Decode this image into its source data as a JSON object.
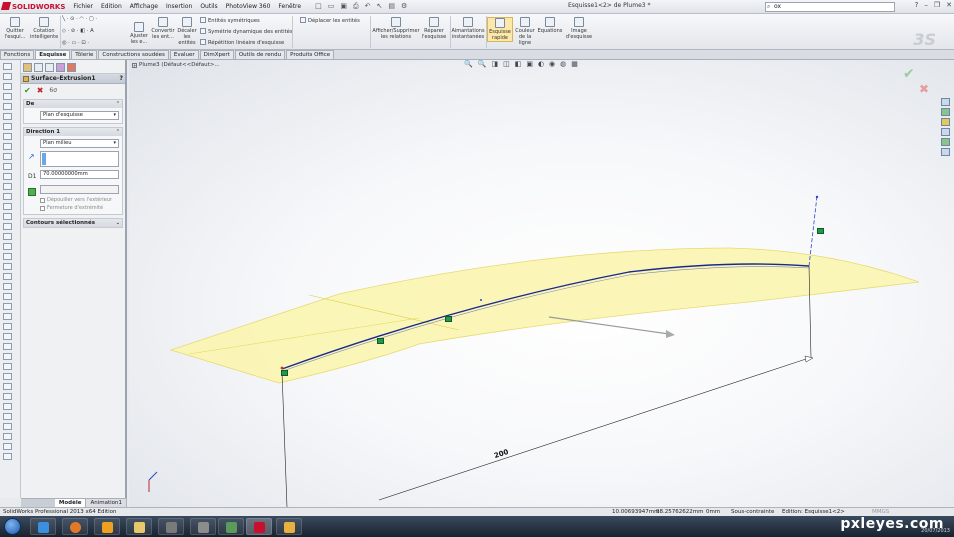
{
  "app": {
    "logo_text": "SOLIDWORKS",
    "doc_title": "Esquisse1<2> de Plume3 *",
    "search_value": "ox",
    "menu": [
      "Fichier",
      "Edition",
      "Affichage",
      "Insertion",
      "Outils",
      "PhotoView 360",
      "Fenêtre"
    ]
  },
  "ribbon": {
    "buttons": [
      {
        "label": "Quitter l'esqui..."
      },
      {
        "label": "Cotation intelligente"
      },
      {
        "label": "Ajuster les e..."
      },
      {
        "label": "Convertir les ent..."
      },
      {
        "label": "Décaler les entités"
      },
      {
        "label": "Afficher/Supprimer les relations"
      },
      {
        "label": "Réparer l'esquisse"
      },
      {
        "label": "Aimantations instantanées"
      },
      {
        "label": "Esquisse rapide"
      },
      {
        "label": "Couleur de la ligne"
      },
      {
        "label": "Equations"
      },
      {
        "label": "Image d'esquisse"
      }
    ],
    "rows": {
      "mirror": "Entités symétriques",
      "dyn_mirror": "Symétrie dynamique des entités",
      "linear_pattern": "Répétition linéaire d'esquisse",
      "move": "Déplacer les entités"
    }
  },
  "tabs": [
    "Fonctions",
    "Esquisse",
    "Tôlerie",
    "Constructions soudées",
    "Evaluer",
    "DimXpert",
    "Outils de rendu",
    "Produits Office"
  ],
  "active_tab": "Esquisse",
  "property_manager": {
    "title": "Surface-Extrusion1",
    "help": "?",
    "from_group": {
      "title": "De",
      "value": "Plan d'esquisse"
    },
    "direction_group": {
      "title": "Direction 1",
      "end_condition": "Plan milieu",
      "depth": "70.00000000mm",
      "draft_out": "Dépouiller vers l'extérieur",
      "cap_end": "Fermeture d'extrémité"
    },
    "contours_group": {
      "title": "Contours sélectionnés"
    }
  },
  "model_tabs": [
    "Modèle",
    "Animation1"
  ],
  "viewport": {
    "tree_node": "Plume3 (Défaut<<Défaut>...",
    "dimension": "200",
    "view_icons": [
      "🔍",
      "🔍",
      "◨",
      "◫",
      "◧",
      "▣",
      "◐",
      "◉",
      "◍",
      "▦"
    ]
  },
  "status": {
    "edition": "SolidWorks Professional 2013 x64 Edition",
    "coord_x": "10.00693947mm",
    "coord_y": "98.25762622mm",
    "coord_z": "0mm",
    "state": "Sous-contrainte",
    "edit": "Edition: Esquisse1<2>",
    "units": "MMGS"
  },
  "taskbar": {
    "watermark": "pxleyes.com",
    "date": "20/07/2013"
  },
  "colors": {
    "accent": "#c8102e",
    "surface_fill": "#fbf6b4",
    "curve": "#1a2a8c",
    "tag_green": "#1f9a4a"
  }
}
